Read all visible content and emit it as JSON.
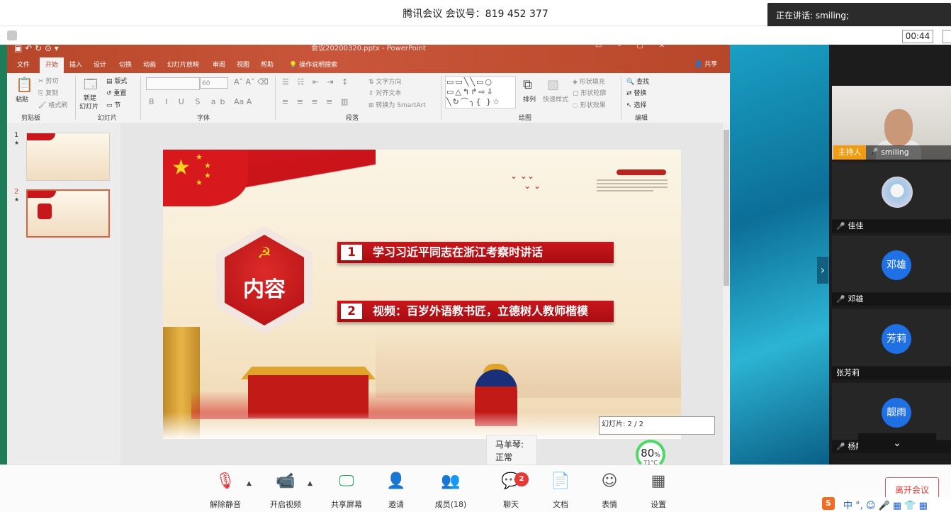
{
  "meeting": {
    "title": "腾讯会议 会议号：819 452 377",
    "speaking": "正在讲话: smiling;",
    "timer": "00:44"
  },
  "ppt": {
    "window_title": "会议20200320.pptx - PowerPoint",
    "tabs": [
      "文件",
      "开始",
      "插入",
      "设计",
      "切换",
      "动画",
      "幻灯片放映",
      "审阅",
      "视图",
      "帮助"
    ],
    "active_tab": "开始",
    "tell_me": "操作说明搜索",
    "share": "共享",
    "ribbon": {
      "clipboard": {
        "paste": "粘贴",
        "cut": "剪切",
        "copy": "复制",
        "format_painter": "格式刷",
        "group": "剪贴板"
      },
      "slides": {
        "new_slide": "新建",
        "new_slide2": "幻灯片",
        "layout": "版式",
        "reset": "重置",
        "section": "节",
        "group": "幻灯片"
      },
      "font": {
        "size": "60",
        "group": "字体"
      },
      "paragraph": {
        "text_direction": "文字方向",
        "align_text": "对齐文本",
        "smartart": "转换为 SmartArt",
        "group": "段落"
      },
      "drawing": {
        "arrange": "排列",
        "quick_styles": "快速样式",
        "shape_fill": "形状填充",
        "shape_outline": "形状轮廓",
        "shape_effects": "形状效果",
        "group": "绘图"
      },
      "editing": {
        "find": "查找",
        "replace": "替换",
        "select": "选择",
        "group": "编辑"
      }
    },
    "thumbnails": [
      {
        "num": "1",
        "star": "★"
      },
      {
        "num": "2",
        "star": "★"
      }
    ],
    "slide_counter": "幻灯片: 2 / 2"
  },
  "slide": {
    "center_label": "内容",
    "items": [
      {
        "num": "1",
        "text": "学习习近平同志在浙江考察时讲话"
      },
      {
        "num": "2",
        "text": "视频：百岁外语教书匠，立德树人教师楷模"
      }
    ]
  },
  "tooltip": {
    "line1": "马羊琴:",
    "line2": "正常"
  },
  "cpu": {
    "value": "80",
    "unit": "%",
    "temp": "71°C"
  },
  "participants": {
    "host_badge": "主持人",
    "host_name": "smiling",
    "others": [
      {
        "name": "佳佳",
        "avatar": ""
      },
      {
        "name": "邓雄",
        "avatar": "邓雄"
      },
      {
        "name": "张芳莉",
        "avatar": "芳莉"
      },
      {
        "name": "杨靓雨",
        "avatar": "靓雨"
      }
    ]
  },
  "toolbar": {
    "unmute": "解除静音",
    "video": "开启视频",
    "share": "共享屏幕",
    "invite": "邀请",
    "members": "成员(18)",
    "chat": "聊天",
    "chat_badge": "2",
    "docs": "文档",
    "reactions": "表情",
    "settings": "设置",
    "leave": "离开会议"
  },
  "ime": {
    "logo": "S",
    "mode": "中"
  },
  "colors": {
    "ppt_accent": "#b7472a",
    "slide_red": "#c9161c",
    "tencent_blue": "#1f6fe5",
    "leave_red": "#e53935"
  }
}
